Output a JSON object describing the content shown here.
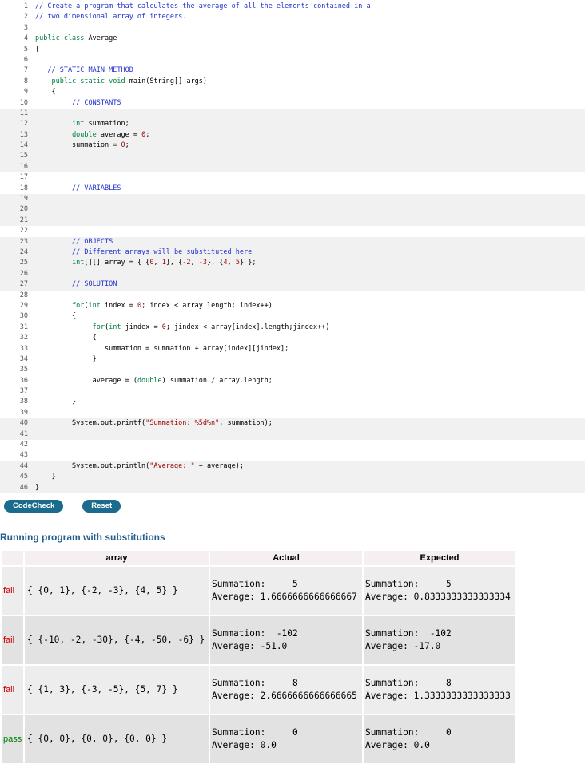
{
  "colors": {
    "comment": "#2233cc",
    "keyword": "#008040",
    "literal": "#990000",
    "code_text": "#000000",
    "gutter_text": "#555555",
    "band_bg": "#f1f1f1",
    "button_bg": "#1a6b8c",
    "button_text": "#ffffff",
    "heading_text": "#235e8c",
    "fail_text": "#cc0000",
    "pass_text": "#008000",
    "table_header_bg": "#f5eff1",
    "row_bg": "#ededed",
    "row_alt_bg": "#e2e2e2"
  },
  "buttons": {
    "codecheck": "CodeCheck",
    "reset": "Reset"
  },
  "editor": {
    "lines": [
      {
        "n": "1",
        "seg": [
          [
            "c",
            "// Create a program that calculates the average of all the elements contained in a"
          ]
        ]
      },
      {
        "n": "2",
        "seg": [
          [
            "c",
            "// two dimensional array of integers."
          ]
        ]
      },
      {
        "n": "3",
        "seg": []
      },
      {
        "n": "4",
        "seg": [
          [
            "k",
            "public class"
          ],
          [
            "p",
            " Average"
          ]
        ]
      },
      {
        "n": "5",
        "seg": [
          [
            "p",
            "{"
          ]
        ]
      },
      {
        "n": "6",
        "seg": []
      },
      {
        "n": "7",
        "seg": [
          [
            "c",
            "   // STATIC MAIN METHOD"
          ]
        ]
      },
      {
        "n": "8",
        "seg": [
          [
            "p",
            "    "
          ],
          [
            "k",
            "public static void"
          ],
          [
            "p",
            " main(String[] args)"
          ]
        ]
      },
      {
        "n": "9",
        "seg": [
          [
            "p",
            "    {"
          ]
        ]
      },
      {
        "n": "10",
        "seg": [
          [
            "c",
            "         // CONSTANTS"
          ]
        ]
      },
      {
        "n": "11",
        "ed": 1,
        "seg": []
      },
      {
        "n": "12",
        "ed": 1,
        "seg": [
          [
            "p",
            "         "
          ],
          [
            "k",
            "int"
          ],
          [
            "p",
            " summation;"
          ]
        ]
      },
      {
        "n": "13",
        "ed": 1,
        "seg": [
          [
            "p",
            "         "
          ],
          [
            "k",
            "double"
          ],
          [
            "p",
            " average = "
          ],
          [
            "l",
            "0"
          ],
          [
            "p",
            ";"
          ]
        ]
      },
      {
        "n": "14",
        "ed": 1,
        "seg": [
          [
            "p",
            "         summation = "
          ],
          [
            "l",
            "0"
          ],
          [
            "p",
            ";"
          ]
        ]
      },
      {
        "n": "15",
        "ed": 1,
        "seg": []
      },
      {
        "n": "16",
        "ed": 1,
        "seg": []
      },
      {
        "n": "17",
        "seg": []
      },
      {
        "n": "18",
        "seg": [
          [
            "c",
            "         // VARIABLES"
          ]
        ]
      },
      {
        "n": "19",
        "ed": 1,
        "seg": []
      },
      {
        "n": "20",
        "ed": 1,
        "seg": []
      },
      {
        "n": "21",
        "ed": 1,
        "seg": []
      },
      {
        "n": "22",
        "seg": []
      },
      {
        "n": "23",
        "ed": 1,
        "seg": [
          [
            "c",
            "         // OBJECTS"
          ]
        ]
      },
      {
        "n": "24",
        "ed": 1,
        "seg": [
          [
            "c",
            "         // Different arrays will be substituted here"
          ]
        ]
      },
      {
        "n": "25",
        "ed": 1,
        "seg": [
          [
            "p",
            "         "
          ],
          [
            "k",
            "int"
          ],
          [
            "p",
            "[][] array = { {"
          ],
          [
            "l",
            "0"
          ],
          [
            "p",
            ", "
          ],
          [
            "l",
            "1"
          ],
          [
            "p",
            "}, {"
          ],
          [
            "l",
            "-2"
          ],
          [
            "p",
            ", "
          ],
          [
            "l",
            "-3"
          ],
          [
            "p",
            "}, {"
          ],
          [
            "l",
            "4"
          ],
          [
            "p",
            ", "
          ],
          [
            "l",
            "5"
          ],
          [
            "p",
            "} };"
          ]
        ]
      },
      {
        "n": "26",
        "ed": 1,
        "seg": []
      },
      {
        "n": "27",
        "ed": 1,
        "seg": [
          [
            "c",
            "         // SOLUTION"
          ]
        ]
      },
      {
        "n": "28",
        "seg": []
      },
      {
        "n": "29",
        "seg": [
          [
            "p",
            "         "
          ],
          [
            "k",
            "for"
          ],
          [
            "p",
            "("
          ],
          [
            "k",
            "int"
          ],
          [
            "p",
            " index = "
          ],
          [
            "l",
            "0"
          ],
          [
            "p",
            "; index < array.length; index++)"
          ]
        ]
      },
      {
        "n": "30",
        "seg": [
          [
            "p",
            "         {"
          ]
        ]
      },
      {
        "n": "31",
        "seg": [
          [
            "p",
            "              "
          ],
          [
            "k",
            "for"
          ],
          [
            "p",
            "("
          ],
          [
            "k",
            "int"
          ],
          [
            "p",
            " jindex = "
          ],
          [
            "l",
            "0"
          ],
          [
            "p",
            "; jindex < array[index].length;jindex++)"
          ]
        ]
      },
      {
        "n": "32",
        "seg": [
          [
            "p",
            "              {"
          ]
        ]
      },
      {
        "n": "33",
        "seg": [
          [
            "p",
            "                 summation = summation + array[index][jindex];"
          ]
        ]
      },
      {
        "n": "34",
        "seg": [
          [
            "p",
            "              }"
          ]
        ]
      },
      {
        "n": "35",
        "seg": []
      },
      {
        "n": "36",
        "seg": [
          [
            "p",
            "              average = ("
          ],
          [
            "k",
            "double"
          ],
          [
            "p",
            ") summation / array.length;"
          ]
        ]
      },
      {
        "n": "37",
        "seg": []
      },
      {
        "n": "38",
        "seg": [
          [
            "p",
            "         }"
          ]
        ]
      },
      {
        "n": "39",
        "seg": []
      },
      {
        "n": "40",
        "ed": 1,
        "seg": [
          [
            "p",
            "         System.out.printf("
          ],
          [
            "s",
            "\"Summation: %5d%n\""
          ],
          [
            "p",
            ", summation);"
          ]
        ]
      },
      {
        "n": "41",
        "ed": 1,
        "seg": []
      },
      {
        "n": "42",
        "seg": []
      },
      {
        "n": "43",
        "seg": []
      },
      {
        "n": "44",
        "ed": 1,
        "seg": [
          [
            "p",
            "         System.out.println("
          ],
          [
            "s",
            "\"Average: \""
          ],
          [
            "p",
            " + average);"
          ]
        ]
      },
      {
        "n": "45",
        "ed": 1,
        "seg": [
          [
            "p",
            "    }"
          ]
        ]
      },
      {
        "n": "46",
        "ed": 1,
        "seg": [
          [
            "p",
            "}"
          ]
        ]
      }
    ]
  },
  "results": {
    "heading": "Running program with substitutions",
    "headers": [
      "",
      "array",
      "Actual",
      "Expected"
    ],
    "rows": [
      {
        "status": "fail",
        "array": "{ {0, 1}, {-2, -3}, {4, 5} }",
        "actual": [
          "Summation:     5",
          "Average: 1.6666666666666667"
        ],
        "expected": [
          "Summation:     5",
          "Average: 0.8333333333333334"
        ]
      },
      {
        "status": "fail",
        "array": "{ {-10, -2, -30}, {-4, -50, -6} }",
        "actual": [
          "Summation:  -102",
          "Average: -51.0"
        ],
        "expected": [
          "Summation:  -102",
          "Average: -17.0"
        ]
      },
      {
        "status": "fail",
        "array": "{ {1, 3}, {-3, -5}, {5, 7} }",
        "actual": [
          "Summation:     8",
          "Average: 2.6666666666666665"
        ],
        "expected": [
          "Summation:     8",
          "Average: 1.3333333333333333"
        ]
      },
      {
        "status": "pass",
        "array": "{ {0, 0}, {0, 0}, {0, 0} }",
        "actual": [
          "Summation:     0",
          "Average: 0.0"
        ],
        "expected": [
          "Summation:     0",
          "Average: 0.0"
        ]
      }
    ]
  }
}
